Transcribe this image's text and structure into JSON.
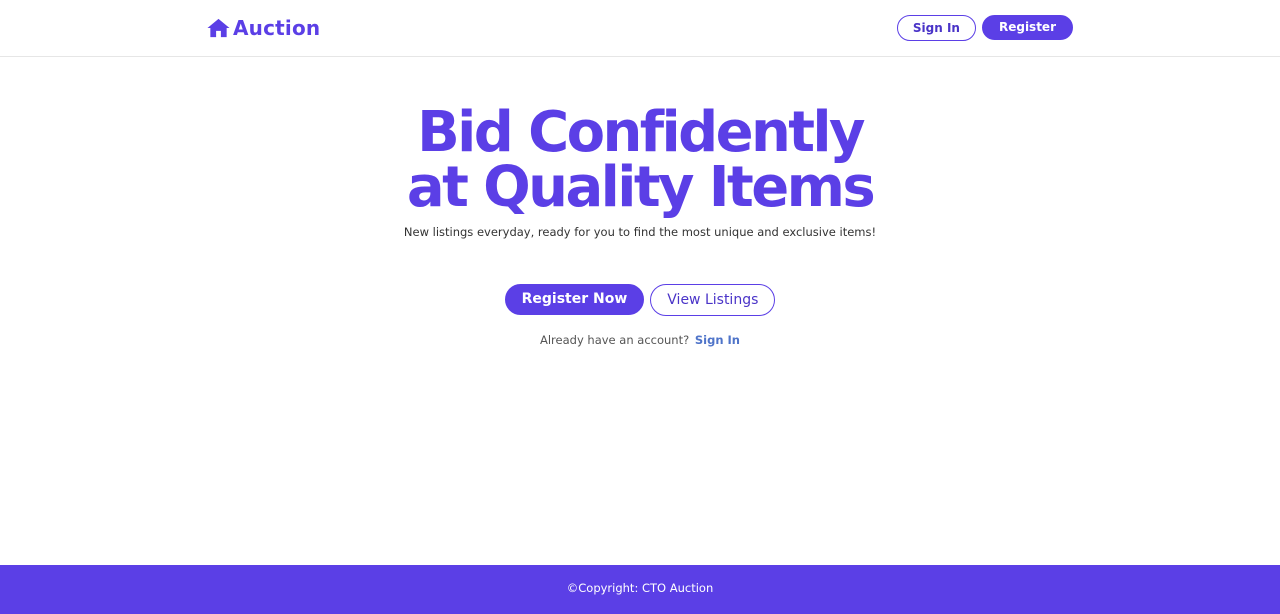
{
  "navbar": {
    "brand_text": "Auction",
    "brand_icon": "home-icon",
    "sign_in_label": "Sign In",
    "register_label": "Register"
  },
  "hero": {
    "title": "Bid Confidently at Quality Items",
    "subtitle": "New listings everyday, ready for you to find the most unique and exclusive items!",
    "register_now_label": "Register Now",
    "view_listings_label": "View Listings",
    "account_prompt": "Already have an account?",
    "account_link": "Sign In"
  },
  "footer": {
    "copyright": "©Copyright: CTO Auction"
  },
  "colors": {
    "accent": "#5b3fe6",
    "link": "#4f74c9",
    "text": "#333333"
  }
}
